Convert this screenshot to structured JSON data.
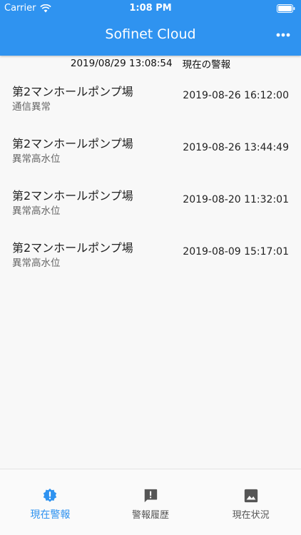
{
  "status_bar": {
    "carrier": "Carrier",
    "time": "1:08 PM"
  },
  "header": {
    "title": "Sofinet Cloud",
    "menu_icon": "more-horizontal-icon"
  },
  "subheader": {
    "timestamp": "2019/08/29 13:08:54",
    "label": "現在の警報"
  },
  "alarms": [
    {
      "name": "第2マンホールポンプ場",
      "status": "通信異常",
      "time": "2019-08-26 16:12:00"
    },
    {
      "name": "第2マンホールポンプ場",
      "status": "異常高水位",
      "time": "2019-08-26 13:44:49"
    },
    {
      "name": "第2マンホールポンプ場",
      "status": "異常高水位",
      "time": "2019-08-20 11:32:01"
    },
    {
      "name": "第2マンホールポンプ場",
      "status": "異常高水位",
      "time": "2019-08-09 15:17:01"
    }
  ],
  "tabs": [
    {
      "label": "現在警報",
      "icon": "alert-badge-icon",
      "active": true
    },
    {
      "label": "警報履歴",
      "icon": "alert-message-icon",
      "active": false
    },
    {
      "label": "現在状況",
      "icon": "image-icon",
      "active": false
    }
  ],
  "colors": {
    "primary": "#2f93f0",
    "inactive_icon": "#555555"
  }
}
